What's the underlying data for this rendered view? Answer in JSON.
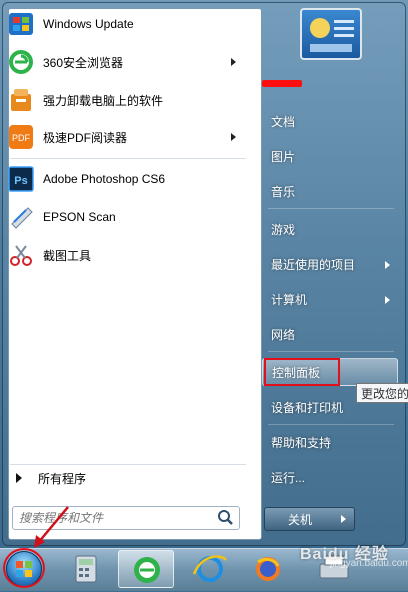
{
  "programs": [
    {
      "label": "Windows Update",
      "icon": "windows-update-icon",
      "submenu": false
    },
    {
      "label": "360安全浏览器",
      "icon": "360-browser-icon",
      "submenu": true
    },
    {
      "label": "强力卸载电脑上的软件",
      "icon": "uninstaller-icon",
      "submenu": false
    },
    {
      "label": "极速PDF阅读器",
      "icon": "pdf-reader-icon",
      "submenu": true
    },
    {
      "label": "Adobe Photoshop CS6",
      "icon": "photoshop-icon",
      "submenu": false
    },
    {
      "label": "EPSON Scan",
      "icon": "epson-scan-icon",
      "submenu": false
    },
    {
      "label": "截图工具",
      "icon": "snipping-tool-icon",
      "submenu": false
    }
  ],
  "all_programs_label": "所有程序",
  "search": {
    "placeholder": "搜索程序和文件"
  },
  "right_items": [
    {
      "label": "文档",
      "submenu": false
    },
    {
      "label": "图片",
      "submenu": false
    },
    {
      "label": "音乐",
      "submenu": false
    },
    {
      "label": "游戏",
      "submenu": false
    },
    {
      "label": "最近使用的项目",
      "submenu": true
    },
    {
      "label": "计算机",
      "submenu": true
    },
    {
      "label": "网络",
      "submenu": false
    },
    {
      "label": "控制面板",
      "submenu": false
    },
    {
      "label": "设备和打印机",
      "submenu": false
    },
    {
      "label": "帮助和支持",
      "submenu": false
    },
    {
      "label": "运行...",
      "submenu": false
    }
  ],
  "tooltip": "更改您的",
  "shutdown_label": "关机",
  "watermark": "Baidu 经验",
  "watermark_sub": "jingyan.baidu.com",
  "colors": {
    "highlight_box": "#e2101a",
    "tooltip_bg": "#f4f6fa"
  }
}
